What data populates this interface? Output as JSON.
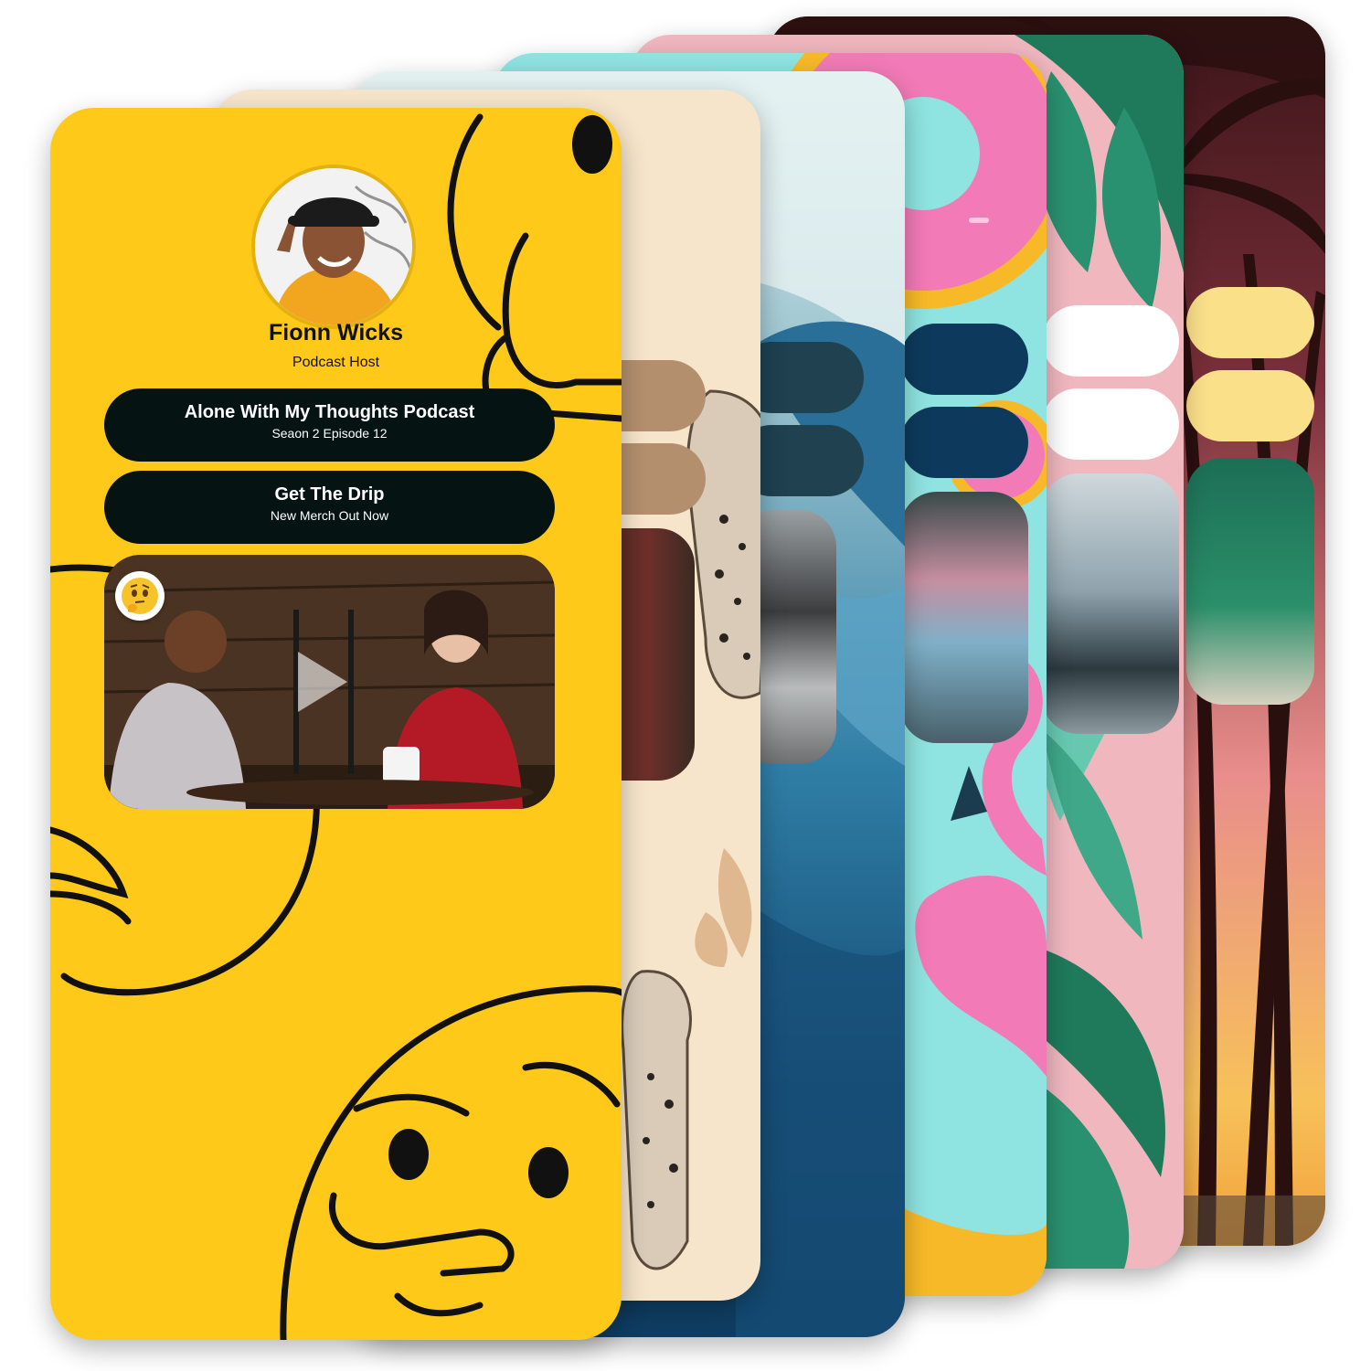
{
  "profile": {
    "name": "Fionn Wicks",
    "role": "Podcast Host"
  },
  "links": [
    {
      "title": "Alone With My Thoughts Podcast",
      "subtitle": "Seaon 2 Episode 12"
    },
    {
      "title": "Get The Drip",
      "subtitle": "New Merch Out Now"
    }
  ],
  "video": {
    "play_icon": "play-icon",
    "badge_icon": "thinking-face-icon"
  },
  "themes": [
    {
      "name": "thinking-emoji",
      "color": "#FFC91A"
    },
    {
      "name": "leopard",
      "color": "#F6E5CB"
    },
    {
      "name": "ocean-wave",
      "color": "#2F7EA6"
    },
    {
      "name": "flamingo-float",
      "color": "#8FE3E0"
    },
    {
      "name": "tropical-leaves",
      "color": "#F0B7BF"
    },
    {
      "name": "palm-sunset",
      "color": "#E98E8C"
    }
  ],
  "colors": {
    "button_dark": "#061313",
    "accent_yellow": "#FFC91A"
  }
}
